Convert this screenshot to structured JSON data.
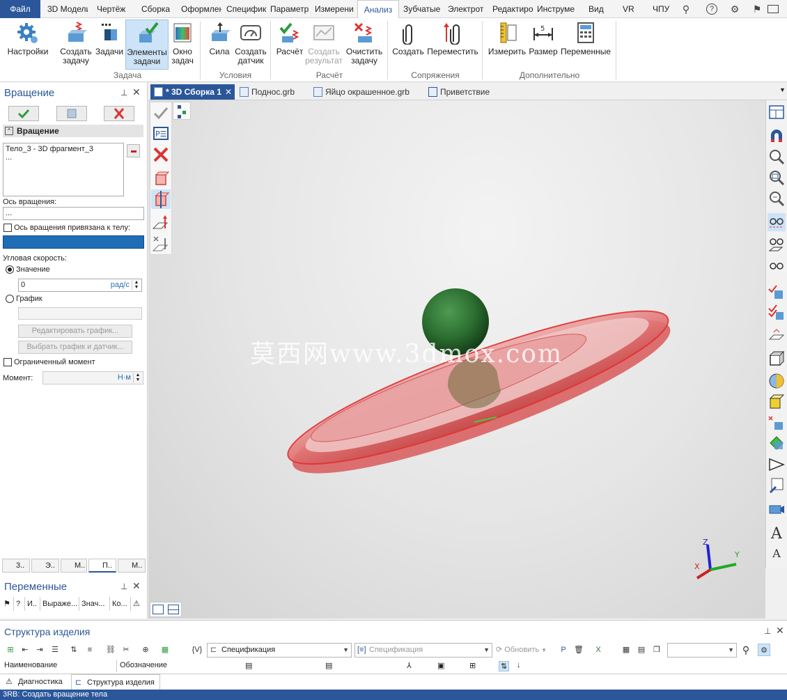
{
  "menu": {
    "tabs": [
      "Файл",
      "3D Модели",
      "Чертёж",
      "Сборка",
      "Оформлен",
      "Специфик",
      "Параметр",
      "Измерени",
      "Анализ",
      "Зубчатые",
      "Электрот",
      "Редактиро",
      "Инструме",
      "Вид",
      "VR",
      "ЧПУ"
    ],
    "active": "Анализ"
  },
  "ribbon": {
    "groups": [
      {
        "label": "Задача",
        "buttons": [
          "Настройки",
          "Создать задачу",
          "Задачи",
          "Элементы задачи",
          "Окно задач"
        ]
      },
      {
        "label": "Условия",
        "buttons": [
          "Сила",
          "Создать датчик"
        ]
      },
      {
        "label": "Расчёт",
        "buttons": [
          "Расчёт",
          "Создать результат",
          "Очистить задачу"
        ]
      },
      {
        "label": "Сопряжения",
        "buttons": [
          "Создать",
          "Переместить"
        ]
      },
      {
        "label": "Дополнительно",
        "buttons": [
          "Измерить",
          "Размер",
          "Переменные"
        ]
      }
    ],
    "selected": "Элементы задачи",
    "disabled": "Создать результат"
  },
  "rotation_panel": {
    "title": "Вращение",
    "section": "Вращение",
    "body_list": [
      "Тело_3 - 3D фрагмент_3",
      "..."
    ],
    "axis_label": "Ось вращения:",
    "axis_value": "...",
    "axis_bound_label": "Ось вращения привязана к телу:",
    "angular_speed_label": "Угловая скорость:",
    "value_option": "Значение",
    "value": "0",
    "unit": "рад/с",
    "graph_option": "График",
    "edit_graph_button": "Редактировать график...",
    "choose_graph_button": "Выбрать график и датчик...",
    "limited_moment_label": "Ограниченный момент",
    "moment_label": "Момент:",
    "moment_unit": "Н·м"
  },
  "panel_tabs": [
    "3..",
    "Э..",
    "М..",
    "П..",
    "М.."
  ],
  "variables_panel": {
    "title": "Переменные",
    "columns": [
      "?",
      "И..",
      "Выраже...",
      "Знач...",
      "Ко..."
    ]
  },
  "doc_tabs": [
    {
      "label": "* 3D Сборка 1",
      "active": true
    },
    {
      "label": "Поднос.grb",
      "active": false
    },
    {
      "label": "Яйцо окрашенное.grb",
      "active": false
    },
    {
      "label": "Приветствие",
      "active": false
    }
  ],
  "viewport": {
    "watermark": "莫西网www.3dmox.com",
    "axes": {
      "x": "X",
      "y": "Y",
      "z": "Z"
    }
  },
  "structure_panel": {
    "title": "Структура изделия",
    "spec_combo": "Спецификация",
    "spec_combo2": "Спецификация",
    "update_label": "Обновить",
    "columns": [
      "Наименование",
      "Обозначение"
    ]
  },
  "bottom_tabs": [
    "Диагностика",
    "Структура изделия"
  ],
  "status": "3RB: Создать вращение тела",
  "colors": {
    "accent": "#2b579a",
    "selection": "#1f6db5",
    "ring": "#e06868",
    "ball": "#2e7a35"
  }
}
